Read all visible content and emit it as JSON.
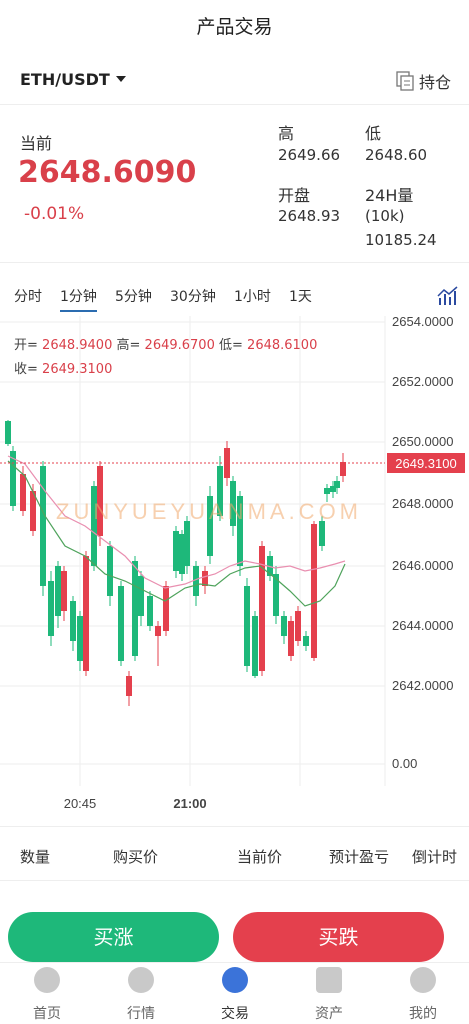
{
  "header": {
    "title": "产品交易"
  },
  "pair": {
    "label": "ETH/USDT",
    "hold_label": "持仓"
  },
  "ticker": {
    "current_label": "当前",
    "current_price": "2648.6090",
    "change": "-0.01%",
    "high_label": "高",
    "high": "2649.66",
    "low_label": "低",
    "low": "2648.60",
    "open_label": "开盘",
    "open": "2648.93",
    "vol_label": "24H量",
    "vol_unit": "(10k)",
    "vol": "10185.24"
  },
  "tabs": [
    "分时",
    "1分钟",
    "5分钟",
    "30分钟",
    "1小时",
    "1天"
  ],
  "active_tab": "1分钟",
  "ohlc": {
    "open_label": "开=",
    "open": "2648.9400",
    "high_label": "高=",
    "high": "2649.6700",
    "low_label": "低=",
    "low": "2648.6100",
    "close_label": "收=",
    "close": "2649.3100"
  },
  "chart_data": {
    "type": "candlestick",
    "y_ticks": [
      "2654.0000",
      "2652.0000",
      "2650.0000",
      "2648.0000",
      "2646.0000",
      "2644.0000",
      "2642.0000",
      "0.00"
    ],
    "x_ticks": [
      "20:45",
      "21:00"
    ],
    "last_price_label": "2649.3100",
    "watermark": "ZUNYUEYUANMA.COM",
    "colors": {
      "up": "#1eb87a",
      "down": "#e4404d",
      "ma1": "#e98fb0",
      "ma2": "#4fa35c"
    }
  },
  "list_head": {
    "qty": "数量",
    "buy_price": "购买价",
    "cur_price": "当前价",
    "est_pl": "预计盈亏",
    "countdown": "倒计时"
  },
  "actions": {
    "buy_up": "买涨",
    "buy_down": "买跌"
  },
  "nav": [
    {
      "label": "首页",
      "icon": "home-icon"
    },
    {
      "label": "行情",
      "icon": "market-icon"
    },
    {
      "label": "交易",
      "icon": "trade-icon"
    },
    {
      "label": "资产",
      "icon": "wallet-icon"
    },
    {
      "label": "我的",
      "icon": "profile-icon"
    }
  ]
}
